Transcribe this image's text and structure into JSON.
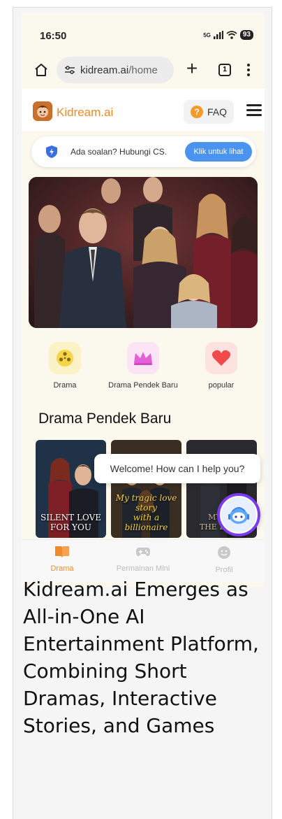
{
  "status_bar": {
    "time": "16:50",
    "network": "5G",
    "battery": "93"
  },
  "browser": {
    "url_domain": "kidream.ai",
    "url_path": "/home",
    "tab_count": "1"
  },
  "site": {
    "brand": "Kidream.ai",
    "faq_label": "FAQ",
    "faq_badge": "?"
  },
  "support": {
    "text": "Ada soalan? Hubungi CS.",
    "button_label": "Klik untuk lihat"
  },
  "categories": [
    {
      "label": "Drama",
      "icon": "film-reel-icon",
      "color": "#f5d64a"
    },
    {
      "label": "Drama Pendek Baru",
      "icon": "crown-icon",
      "color": "#e45fd8"
    },
    {
      "label": "popular",
      "icon": "heart-icon",
      "color": "#f04a4a"
    }
  ],
  "section_title": "Drama Pendek Baru",
  "posters": [
    {
      "caption_line1": "SILENT LOVE",
      "caption_line2": "FOR YOU"
    },
    {
      "caption_line1": "My tragic love story",
      "caption_line2": "with a billionaire"
    },
    {
      "caption_line1": "MY DE",
      "caption_line2": "THE DAUG"
    }
  ],
  "chat": {
    "welcome": "Welcome! How can I help you?"
  },
  "bottom_nav": [
    {
      "label": "Drama",
      "active": true
    },
    {
      "label": "Permainan Mini",
      "active": false
    },
    {
      "label": "Profil",
      "active": false
    }
  ],
  "headline": "Kidream.ai Emerges as All-in-One AI Entertainment Platform, Combining Short Dramas, Interactive Stories, and Games",
  "colors": {
    "accent": "#f08a2a",
    "support_button": "#4a94f0",
    "bot_ring": "#7a3cf0",
    "page_bg": "#fbf8ee"
  }
}
